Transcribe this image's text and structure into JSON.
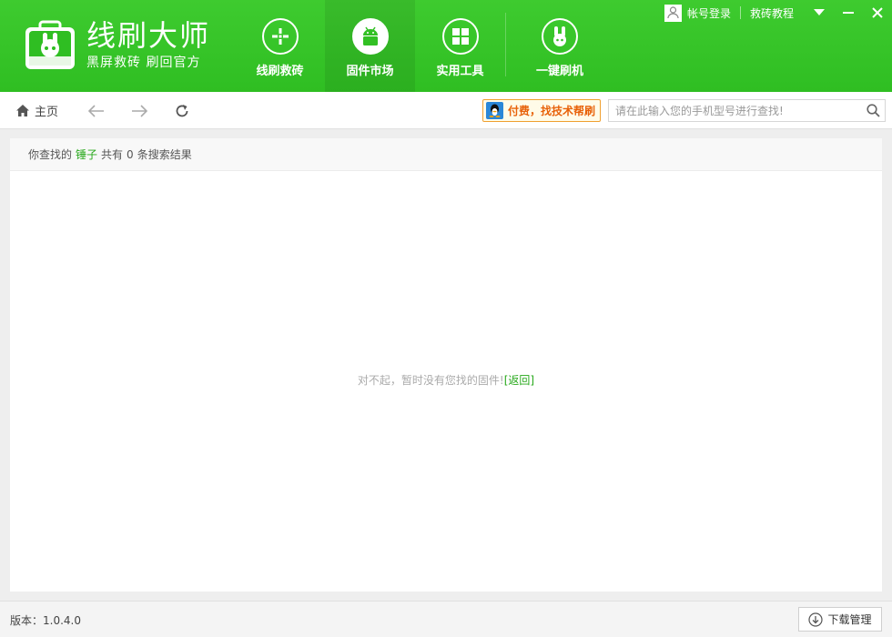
{
  "app": {
    "name": "线刷大师",
    "tagline": "黑屏救砖 刷回官方"
  },
  "nav": [
    {
      "label": "线刷救砖",
      "icon": "crosshair-icon",
      "active": false
    },
    {
      "label": "固件市场",
      "icon": "android-icon",
      "active": true
    },
    {
      "label": "实用工具",
      "icon": "grid-icon",
      "active": false
    },
    {
      "label": "一键刷机",
      "icon": "rabbit-icon",
      "active": false
    }
  ],
  "window_tools": {
    "login_label": "帐号登录",
    "tutorial_label": "救砖教程"
  },
  "toolbar": {
    "home_label": "主页",
    "qq_help_label": "付费，找技术帮刷",
    "search_placeholder": "请在此输入您的手机型号进行查找!"
  },
  "result": {
    "prefix": "你查找的",
    "keyword": "锤子",
    "middle": "共有",
    "count": "0",
    "suffix": "条搜索结果"
  },
  "empty": {
    "message": "对不起，暂时没有您找的固件!",
    "back_link": "[返回]"
  },
  "status": {
    "version": "版本：1.0.4.0",
    "download_label": "下载管理"
  },
  "colors": {
    "brand_green": "#32c024",
    "link_green": "#27a81b",
    "qq_orange": "#e8620a"
  }
}
